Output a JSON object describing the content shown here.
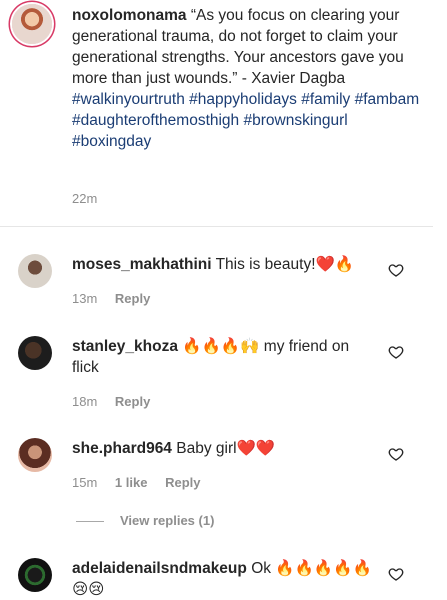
{
  "caption": {
    "username": "noxolomonama",
    "text": "“As you focus on clearing your generational trauma, do not forget to claim your generational strengths. Your ancestors gave you more than just wounds.” - Xavier Dagba",
    "hashtags": "#walkinyourtruth #happyholidays #family #fambam #daughterofthemosthigh #brownskingurl #boxingday",
    "time": "22m"
  },
  "comments": [
    {
      "username": "moses_makhathini",
      "text": "This is beauty!❤️🔥",
      "time": "13m",
      "reply_label": "Reply"
    },
    {
      "username": "stanley_khoza",
      "text": "🔥🔥🔥🙌 my friend on flick",
      "time": "18m",
      "reply_label": "Reply"
    },
    {
      "username": "she.phard964",
      "text": "Baby girl❤️❤️",
      "time": "15m",
      "likes": "1 like",
      "reply_label": "Reply"
    },
    {
      "username": "adelaidenailsndmakeup",
      "text": "Ok 🔥🔥🔥🔥🔥😢😢"
    }
  ],
  "view_replies": "View replies (1)",
  "icons": {
    "heart": "heart-outline-icon"
  },
  "colors": {
    "hashtag": "#1b3d74",
    "meta": "#8e8e8e",
    "text": "#262626"
  }
}
